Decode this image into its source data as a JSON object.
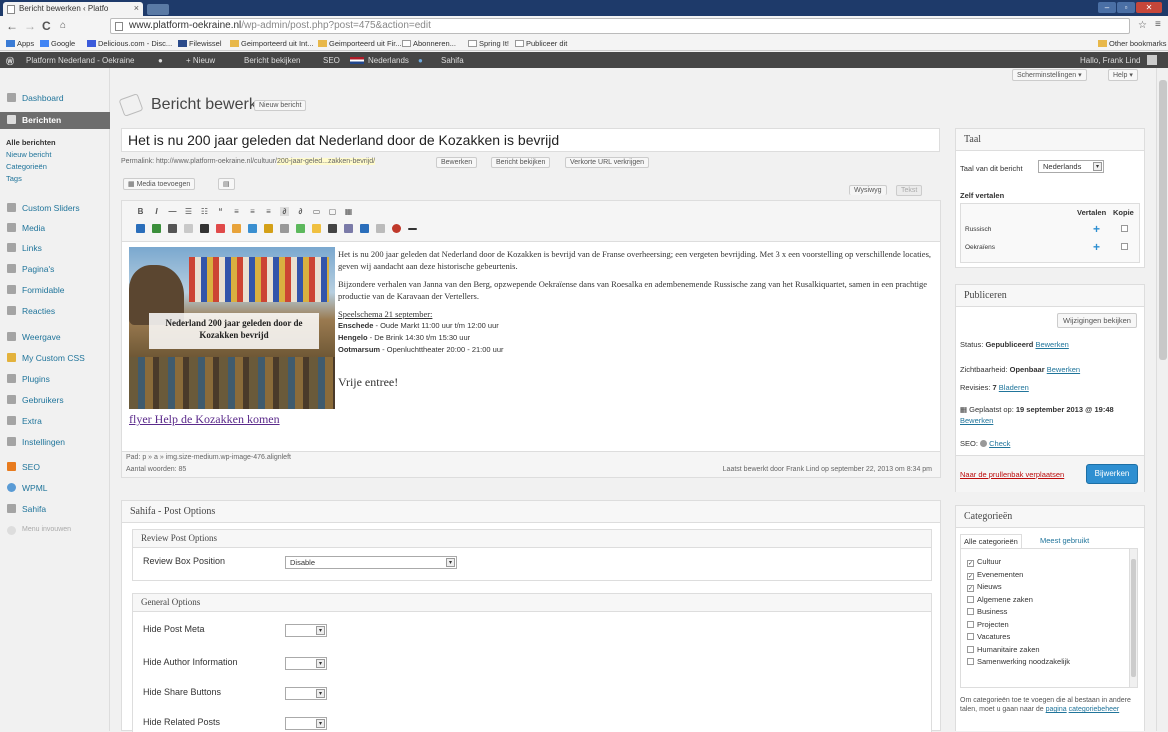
{
  "browser": {
    "tab_title": "Bericht bewerken ‹ Platfo",
    "url_host": "www.platform-oekraine.nl",
    "url_path": "/wp-admin/post.php?post=475&action=edit",
    "bookmarks": [
      "Apps",
      "Google",
      "Delicious.com - Disc...",
      "Filewissel",
      "Geimporteerd uit Int...",
      "Geimporteerd uit Fir...",
      "Abonneren...",
      "Spring It!",
      "Publiceer dit"
    ],
    "other_bookmarks": "Other bookmarks"
  },
  "adminbar": {
    "site": "Platform Nederland - Oekraine",
    "new": "+ Nieuw",
    "view": "Bericht bekijken",
    "seo": "SEO",
    "lang": "Nederlands",
    "sahifa": "Sahifa",
    "greeting": "Hallo, Frank Lind"
  },
  "sidebar": {
    "dashboard": "Dashboard",
    "berichten": "Berichten",
    "sub": [
      "Alle berichten",
      "Nieuw bericht",
      "Categorieën",
      "Tags"
    ],
    "items": [
      "Custom Sliders",
      "Media",
      "Links",
      "Pagina's",
      "Formidable",
      "Reacties",
      "Weergave",
      "My Custom CSS",
      "Plugins",
      "Gebruikers",
      "Extra",
      "Instellingen",
      "SEO",
      "WPML",
      "Sahifa"
    ],
    "collapse": "Menu invouwen"
  },
  "page": {
    "title": "Bericht bewerken",
    "new_post": "Nieuw bericht",
    "screen_options": "Scherminstellingen ▾",
    "help": "Help ▾",
    "post_title": "Het is nu 200 jaar geleden dat Nederland door de Kozakken is bevrijd",
    "permalink_label": "Permalink: http://www.platform-oekraine.nl/cultuur/",
    "permalink_slug": "200-jaar-geled...zakken-bevrijd/",
    "btn_edit": "Bewerken",
    "btn_view": "Bericht bekijken",
    "btn_short": "Verkorte URL verkrijgen",
    "add_media": "Media toevoegen",
    "tab_visual": "Wysiwyg",
    "tab_text": "Tekst"
  },
  "editor": {
    "img_caption": "Nederland 200 jaar geleden door de Kozakken bevrijd",
    "p1": "Het is nu 200 jaar geleden dat Nederland door de Kozakken is bevrijd van de Franse overheersing; een vergeten bevrijding.  Met 3 x een voorstelling op verschillende locaties, geven wij aandacht aan deze historische gebeurtenis.",
    "p2": "Bijzondere verhalen van Janna van den Berg, opzwepende Oekraïense dans van Roesalka en adembenemende Russische zang van het Rusalkiquartet, samen in een prachtige productie van de Karavaan der Vertellers.",
    "schedule_title": "Speelschema 21 september:",
    "s1_city": "Enschede",
    "s1_rest": " - Oude Markt 11:00 uur t/m 12:00 uur",
    "s2_city": "Hengelo",
    "s2_rest": " - De Brink 14:30 t/m 15:30 uur",
    "s3_city": "Ootmarsum",
    "s3_rest": " - Openluchttheater 20:00 - 21:00 uur",
    "free": "Vrije entree!",
    "flyer_link": "flyer Help de Kozakken komen",
    "path": "Pad: p » a » img.size-medium.wp-image-476.alignleft",
    "wordcount": "Aantal woorden: 85",
    "last_edit": "Laatst bewerkt door Frank Lind op september 22, 2013 om 8:34 pm"
  },
  "sahifa": {
    "title": "Sahifa - Post Options",
    "review_header": "Review Post Options",
    "review_label": "Review Box Position",
    "review_value": "Disable",
    "general_header": "General Options",
    "options": [
      "Hide Post Meta",
      "Hide Author Information",
      "Hide Share Buttons",
      "Hide Related Posts"
    ]
  },
  "taal": {
    "title": "Taal",
    "lang_label": "Taal van dit bericht",
    "lang_value": "Nederlands",
    "self_translate": "Zelf vertalen",
    "col_translate": "Vertalen",
    "col_copy": "Kopie",
    "rows": [
      "Russisch",
      "Oekraïens"
    ]
  },
  "publish": {
    "title": "Publiceren",
    "preview_changes": "Wijzigingen bekijken",
    "status_label": "Status: ",
    "status_value": "Gepubliceerd",
    "visibility_label": "Zichtbaarheid: ",
    "visibility_value": "Openbaar",
    "revisions_label": "Revisies: ",
    "revisions_value": "7",
    "browse": "Bladeren",
    "edit": "Bewerken",
    "published_label": "Geplaatst op: ",
    "published_value": "19 september 2013 @ 19:48",
    "seo_label": "SEO: ",
    "seo_check": "Check",
    "trash": "Naar de prullenbak verplaatsen",
    "update": "Bijwerken"
  },
  "categories": {
    "title": "Categorieën",
    "tab_all": "Alle categorieën",
    "tab_popular": "Meest gebruikt",
    "items": [
      {
        "label": "Cultuur",
        "checked": true
      },
      {
        "label": "Evenementen",
        "checked": true
      },
      {
        "label": "Nieuws",
        "checked": true
      },
      {
        "label": "Algemene zaken",
        "checked": false
      },
      {
        "label": "Business",
        "checked": false
      },
      {
        "label": "Projecten",
        "checked": false
      },
      {
        "label": "Vacatures",
        "checked": false
      },
      {
        "label": "Humanitaire zaken",
        "checked": false
      },
      {
        "label": "Samenwerking noodzakelijk",
        "checked": false
      }
    ],
    "note": "Om categorieën toe te voegen die al bestaan in andere talen, moet u gaan naar de",
    "note_link1": "pagina",
    "note_link2": "categoriebeheer"
  },
  "colors": {
    "admin_bar": "#464646",
    "link": "#21759b",
    "update_btn": "#2e8fd1",
    "tabbar": "#1e3a6a"
  }
}
